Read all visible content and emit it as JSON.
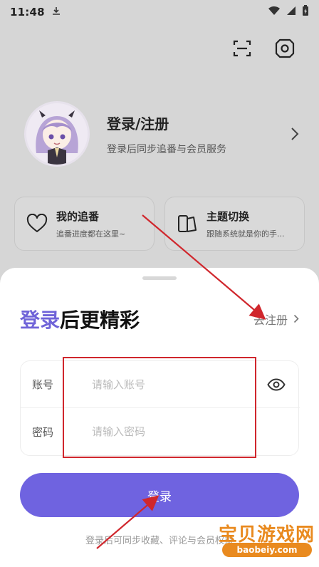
{
  "status_bar": {
    "time": "11:48"
  },
  "profile": {
    "title": "登录/注册",
    "subtitle": "登录后同步追番与会员服务"
  },
  "cards": [
    {
      "title": "我的追番",
      "subtitle": "追番进度都在这里~"
    },
    {
      "title": "主题切换",
      "subtitle": "跟随系统就是你的手..."
    }
  ],
  "login_sheet": {
    "heading_accent": "登录",
    "heading_rest": "后更精彩",
    "register_link": "去注册",
    "account_label": "账号",
    "account_placeholder": "请输入账号",
    "account_value": "",
    "password_label": "密码",
    "password_placeholder": "请输入密码",
    "password_value": "",
    "login_button": "登录",
    "footnote": "登录后可同步收藏、评论与会员权益"
  },
  "watermark": {
    "text": "宝贝游戏网",
    "url": "baobeiy.com"
  },
  "colors": {
    "accent": "#6f63e0",
    "annotation_red": "#d0272d",
    "watermark_orange": "#e98a1f"
  }
}
